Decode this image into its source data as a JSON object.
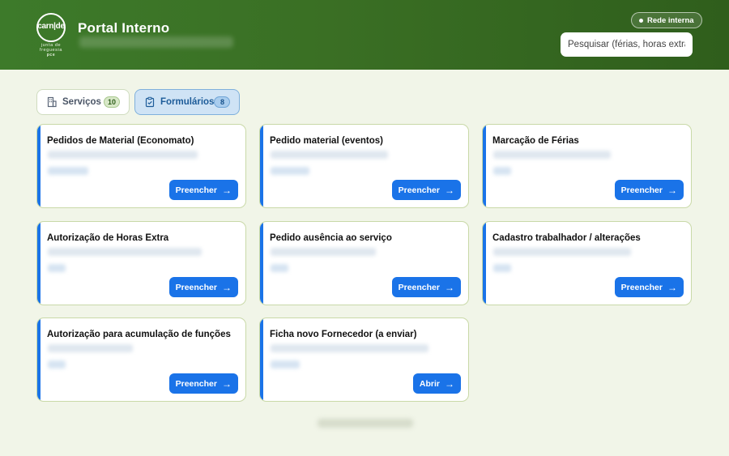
{
  "header": {
    "logo_text": "carn|de",
    "logo_sub1": "junta de",
    "logo_sub2": "freguesia",
    "logo_sub3": "pce",
    "title": "Portal Interno",
    "network_badge": "Rede interna",
    "search_placeholder": "Pesquisar (férias, horas extra, c"
  },
  "tabs": [
    {
      "label": "Serviços",
      "count": "10",
      "icon": "building-icon"
    },
    {
      "label": "Formulários",
      "count": "8",
      "icon": "clipboard-icon"
    }
  ],
  "cards": [
    {
      "title": "Pedidos de Material (Economato)",
      "button": "Preencher"
    },
    {
      "title": "Pedido material (eventos)",
      "button": "Preencher"
    },
    {
      "title": "Marcação de Férias",
      "button": "Preencher"
    },
    {
      "title": "Autorização de Horas Extra",
      "button": "Preencher"
    },
    {
      "title": "Pedido ausência ao serviço",
      "button": "Preencher"
    },
    {
      "title": "Cadastro trabalhador / alterações",
      "button": "Preencher"
    },
    {
      "title": "Autorização para acumulação de funções",
      "button": "Preencher"
    },
    {
      "title": "Ficha novo Fornecedor (a enviar)",
      "button": "Abrir"
    }
  ],
  "arrow": "→",
  "colors": {
    "header_green": "#3a6f24",
    "accent_blue": "#1a73e8",
    "page_bg": "#f1f5e8"
  }
}
